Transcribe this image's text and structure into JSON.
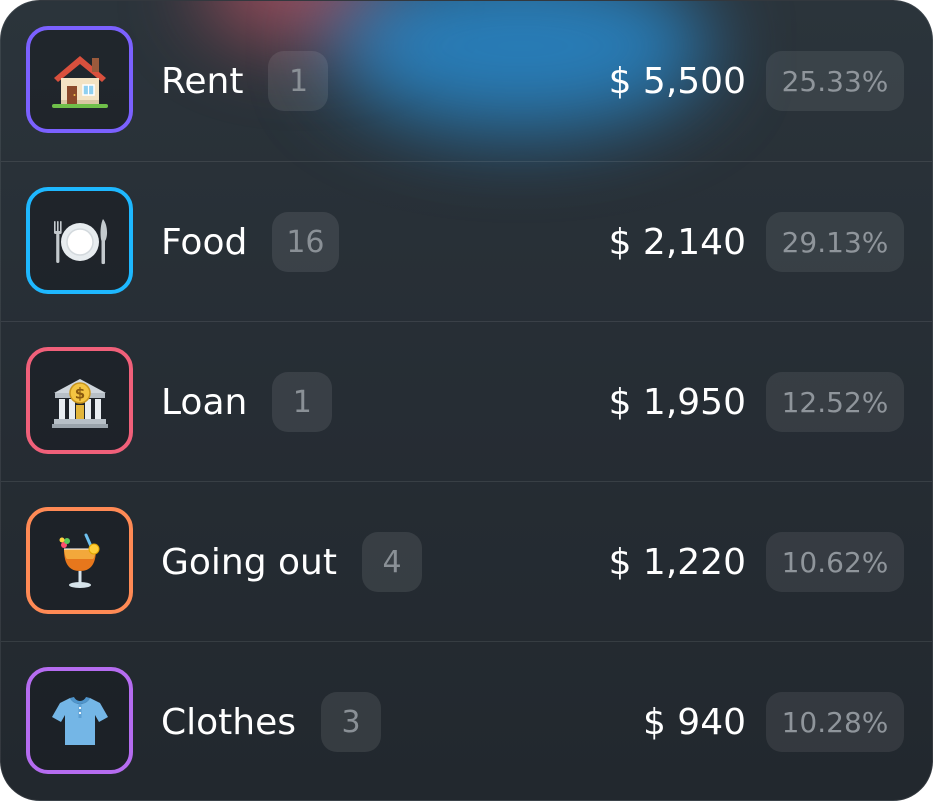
{
  "categories": [
    {
      "label": "Rent",
      "count": "1",
      "amount": "$ 5,500",
      "percent": "25.33%",
      "icon": "house-icon",
      "border_color": "#7b61ff"
    },
    {
      "label": "Food",
      "count": "16",
      "amount": "$ 2,140",
      "percent": "29.13%",
      "icon": "plate-cutlery-icon",
      "border_color": "#1eb8ff"
    },
    {
      "label": "Loan",
      "count": "1",
      "amount": "$ 1,950",
      "percent": "12.52%",
      "icon": "bank-icon",
      "border_color": "#f0607a"
    },
    {
      "label": "Going out",
      "count": "4",
      "amount": "$ 1,220",
      "percent": "10.62%",
      "icon": "cocktail-icon",
      "border_color": "#ff8a55"
    },
    {
      "label": "Clothes",
      "count": "3",
      "amount": "$ 940",
      "percent": "10.28%",
      "icon": "shirt-icon",
      "border_color": "#b56cf0"
    }
  ]
}
